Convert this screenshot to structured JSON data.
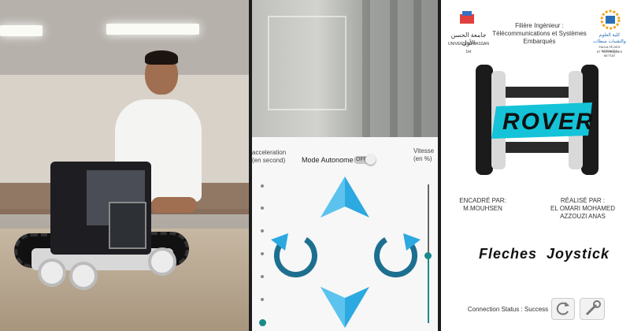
{
  "photo": {
    "description_icon": "photo-icon"
  },
  "camera": {
    "icon": "camera-icon"
  },
  "controls": {
    "acceleration_label": "acceleration\n(en second)",
    "acceleration_line1": "acceleration",
    "acceleration_line2": "(en second)",
    "mode_label": "Mode Autonome",
    "toggle_state": "OFF",
    "vitesse_line1": "Vitesse",
    "vitesse_line2": "(en %)",
    "arrow_color": "#2ba9e0",
    "rotate_color": "#1d6f8f",
    "accent": "#1a8a8a"
  },
  "right": {
    "university_line1": "جامعة الحسن الأول",
    "university_line2": "UNIVERSITÉ HASSAN 1er",
    "filiere_line1": "Filière Ingénieur :",
    "filiere_line2": "Télécommunications et Systèmes",
    "filiere_line3": "Embarqués",
    "faculty_line1": "كلية العلوم",
    "faculty_line2": "والتقنيات سطات",
    "faculty_line3": "FACULTÉ DES SCIENCES",
    "faculty_line4": "ET TECHNIQUES SETTAT",
    "rover_title": "ROVER",
    "encadre_label": "ENCADRÉ PAR:",
    "encadre_name": "M.MOUHSEN",
    "realise_label": "RÉALISÉ  PAR :",
    "realise_name1": "EL OMARI MOHAMED",
    "realise_name2": "AZZOUZI ANAS",
    "fleches_button": "Fleches",
    "joystick_button": "Joystick",
    "connection_status": "Connection Status : Success",
    "refresh_icon": "refresh-icon",
    "settings_icon": "wrench-icon"
  }
}
